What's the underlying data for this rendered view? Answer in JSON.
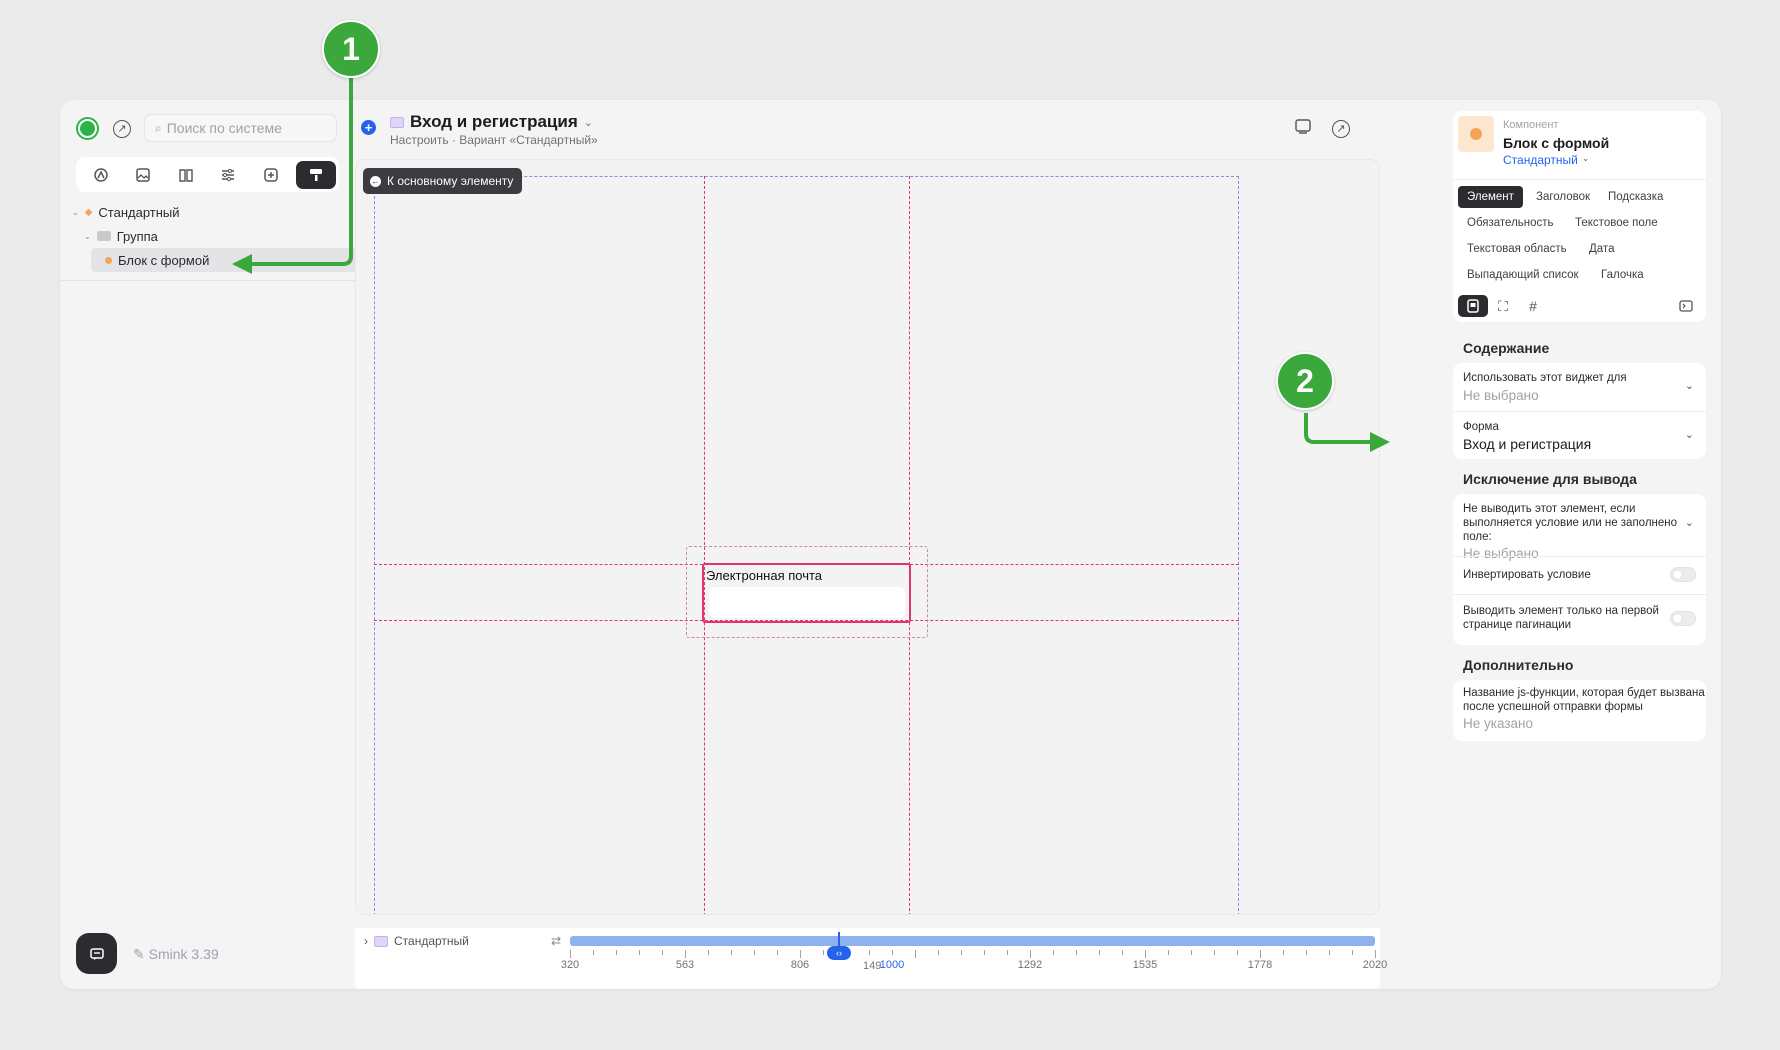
{
  "left": {
    "search_placeholder": "Поиск по системе",
    "toolbar_icons": [
      "brush-icon",
      "image-icon",
      "book-icon",
      "sliders-icon",
      "add-square-icon",
      "paint-roller-icon"
    ],
    "tree": {
      "root": "Стандартный",
      "group": "Группа",
      "item": "Блок с формой"
    },
    "version": "Smink 3.39"
  },
  "header": {
    "title": "Вход и регистрация",
    "subtitle": "Настроить · Вариант «Стандартный»"
  },
  "canvas": {
    "back_button": "К основному элементу",
    "email_label": "Электронная почта"
  },
  "ruler": {
    "variant": "Стандартный",
    "ticks": [
      "320",
      "563",
      "806",
      "1000",
      "1292",
      "1535",
      "1778",
      "2020"
    ],
    "hidden_tick": "149",
    "current": "1000"
  },
  "right": {
    "component_type": "Компонент",
    "component_name": "Блок с формой",
    "variant": "Стандартный",
    "tabs": [
      "Элемент",
      "Заголовок",
      "Подсказка",
      "Обязательность",
      "Текстовое поле",
      "Текстовая область",
      "Дата",
      "Выпадающий список",
      "Галочка"
    ],
    "content_title": "Содержание",
    "use_widget_label": "Использовать этот виджет для",
    "use_widget_value": "Не выбрано",
    "form_label": "Форма",
    "form_value": "Вход и регистрация",
    "exclusion_title": "Исключение для вывода",
    "exclusion_label": "Не выводить этот элемент, если выполняется условие или не заполнено поле:",
    "exclusion_value": "Не выбрано",
    "invert_label": "Инвертировать условие",
    "first_page_label": "Выводить элемент только на первой странице пагинации",
    "extra_title": "Дополнительно",
    "js_label": "Название js-функции, которая будет вызвана после успешной отправки формы",
    "js_value": "Не указано"
  },
  "annotations": [
    "1",
    "2"
  ],
  "colors": {
    "accent_green": "#3aa83a",
    "dark": "#2b2b30",
    "guide_pink": "#e0356e",
    "guide_blue": "#8b8bd6",
    "ruler_track": "#8fb1ee",
    "link_blue": "#2563eb"
  }
}
